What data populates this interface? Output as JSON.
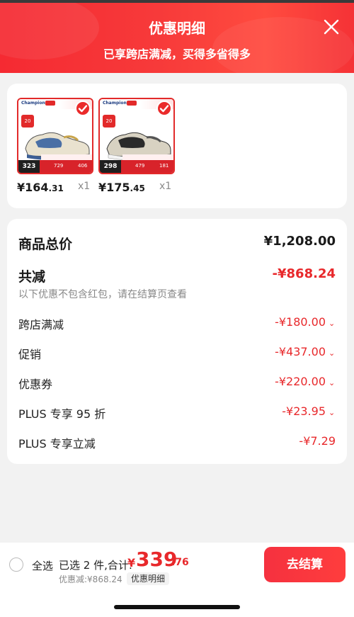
{
  "header": {
    "title": "优惠明细",
    "subtitle": "已享跨店满减，买得多省得多",
    "accent": "#f5303a"
  },
  "products": [
    {
      "brand_text": "Champion",
      "badge": "20",
      "strip_price": "323",
      "strip_n1": "729",
      "strip_n2": "406",
      "price_int": "¥164",
      "price_dec": ".31",
      "qty": "x1",
      "selected": true
    },
    {
      "brand_text": "Champion",
      "badge": "20",
      "strip_price": "298",
      "strip_n1": "479",
      "strip_n2": "181",
      "price_int": "¥175",
      "price_dec": ".45",
      "qty": "x1",
      "selected": true
    }
  ],
  "summary": {
    "total_label": "商品总价",
    "total_value": "¥1,208.00",
    "reduce_label": "共减",
    "reduce_value": "-¥868.24",
    "note": "以下优惠不包含红包，请在结算页查看",
    "items": [
      {
        "label": "跨店满减",
        "value": "-¥180.00",
        "expandable": true
      },
      {
        "label": "促销",
        "value": "-¥437.00",
        "expandable": true
      },
      {
        "label": "优惠券",
        "value": "-¥220.00",
        "expandable": true
      },
      {
        "label": "PLUS 专享 95 折",
        "value": "-¥23.95",
        "expandable": true
      },
      {
        "label": "PLUS 专享立减",
        "value": "-¥7.29",
        "expandable": false
      }
    ]
  },
  "bottom": {
    "select_all": "全选",
    "selected_text": "已选 2 件,合计:",
    "total_yen": "¥",
    "total_int": "339",
    "total_dec": ".76",
    "discount_text": "优惠减:¥868.24",
    "detail_button": "优惠明细",
    "checkout_button": "去结算"
  },
  "colors": {
    "red": "#e8282b",
    "gray_text": "#888888"
  }
}
